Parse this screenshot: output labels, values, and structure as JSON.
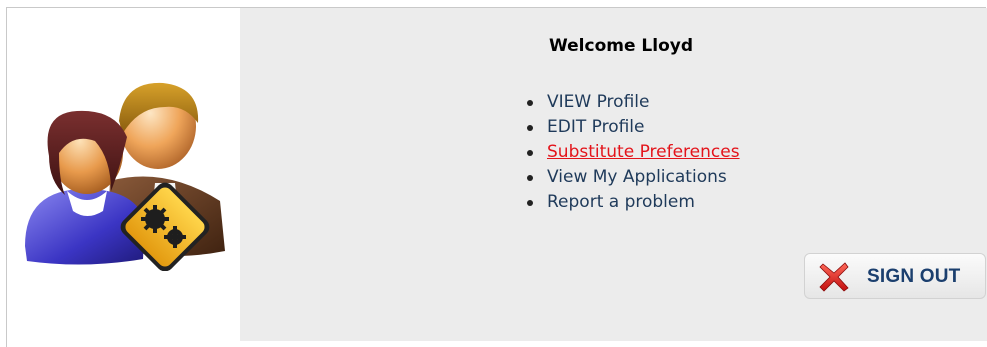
{
  "header": {
    "welcome_prefix": "Welcome",
    "user_name": "Lloyd"
  },
  "menu": {
    "items": [
      {
        "label": "VIEW Profile"
      },
      {
        "label": "EDIT Profile"
      },
      {
        "label": "Substitute Preferences"
      },
      {
        "label": "View My Applications"
      },
      {
        "label": "Report a problem"
      }
    ],
    "active_index": 2
  },
  "actions": {
    "signout_label": "SIGN OUT"
  },
  "icons": {
    "avatar": "users-settings-icon",
    "signout": "red-x-icon"
  },
  "colors": {
    "panel_background": "#ececec",
    "link": "#1f3a5a",
    "link_active": "#e3141b",
    "signout_text": "#1b3f6e"
  }
}
